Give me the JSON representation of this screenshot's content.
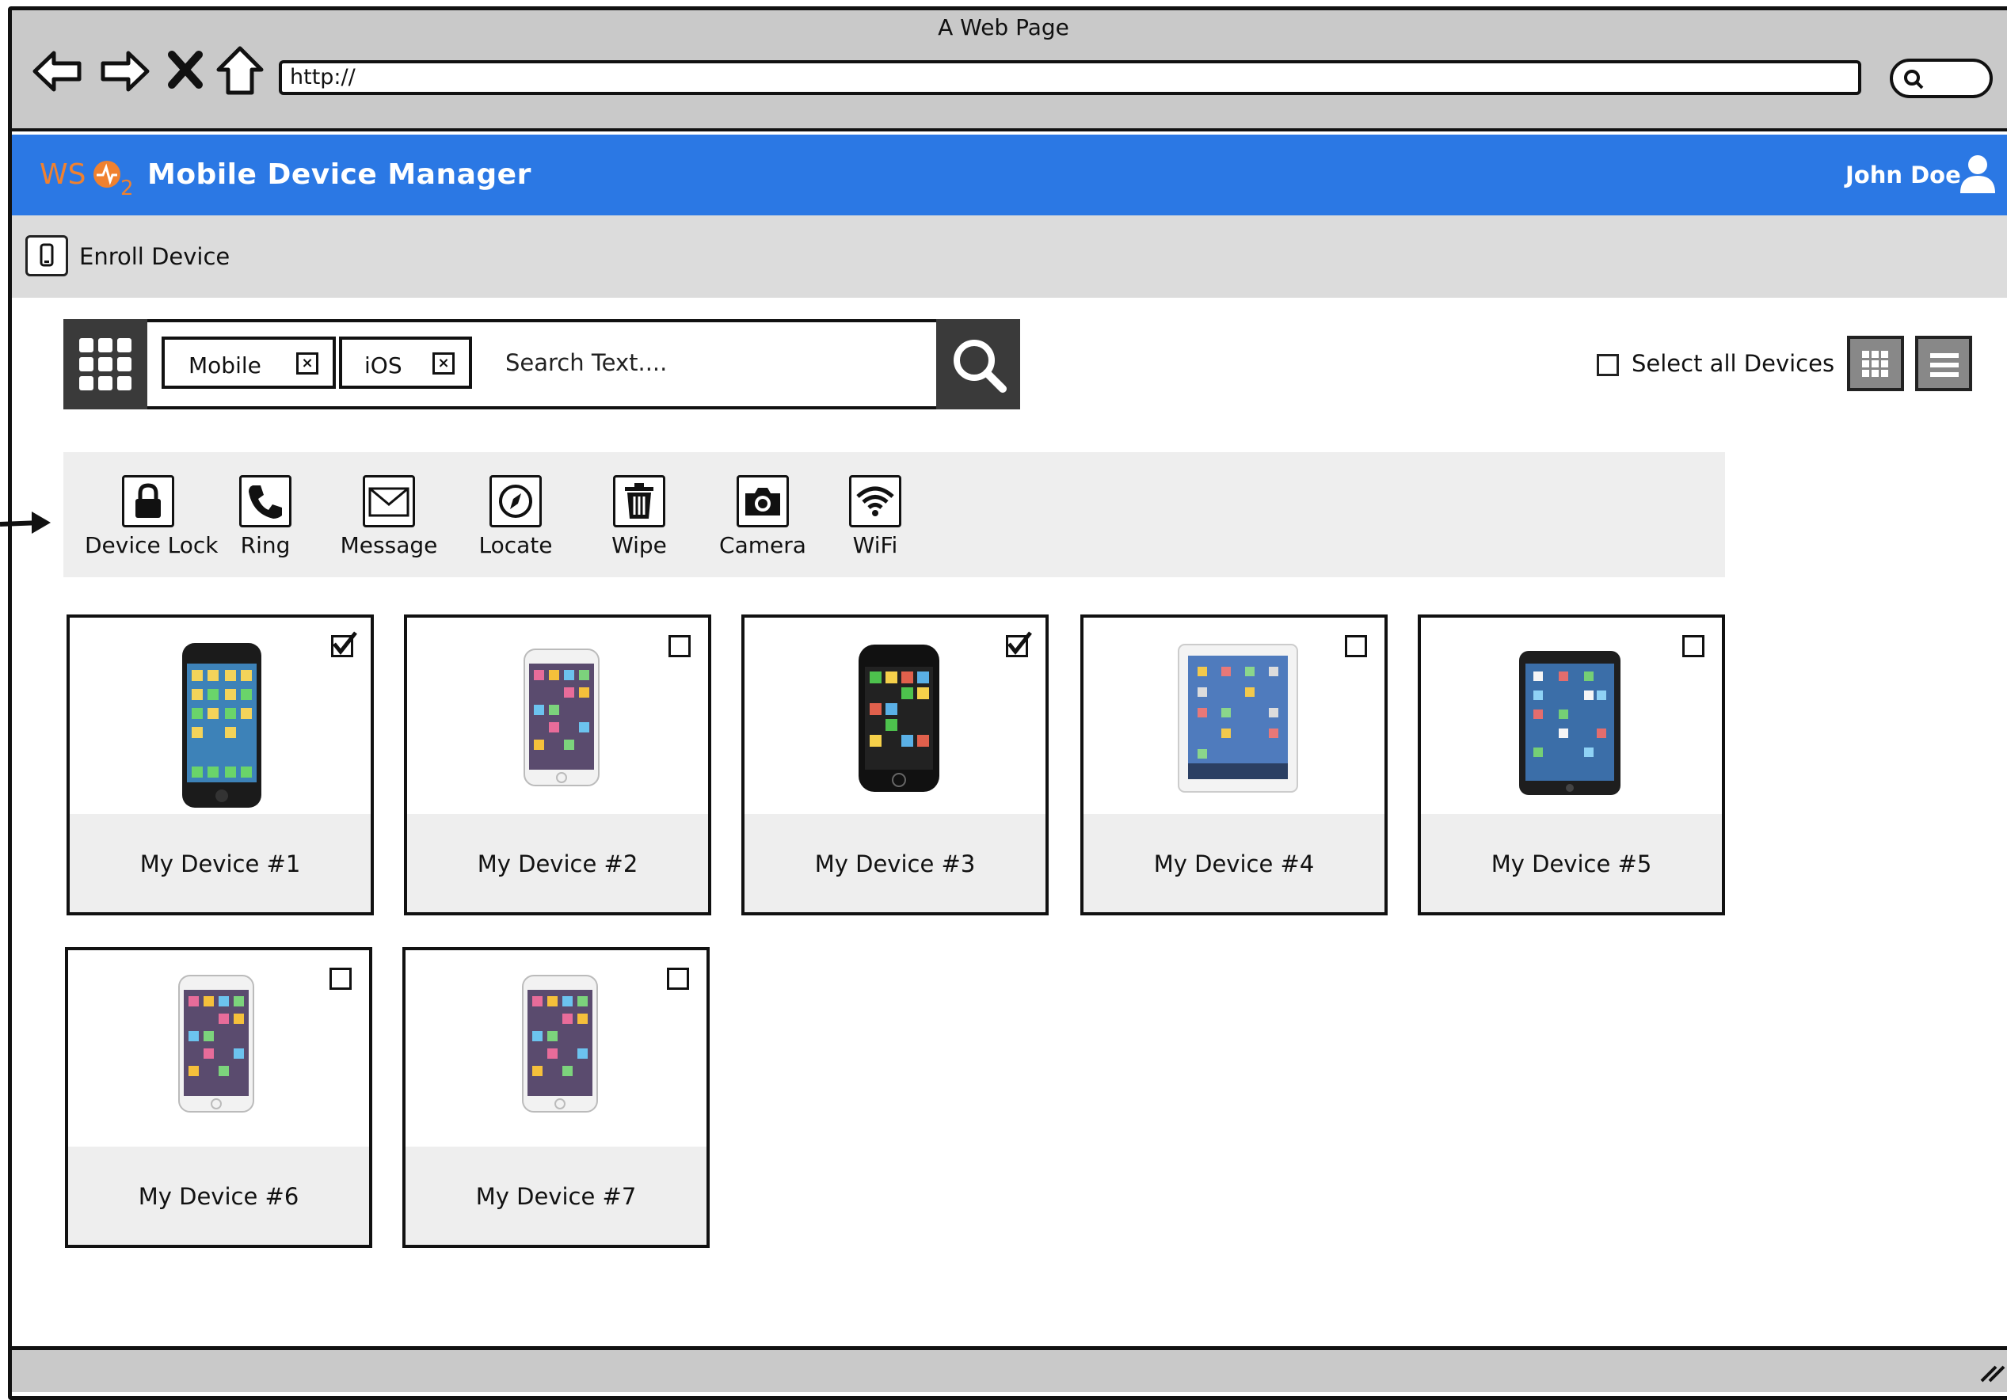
{
  "window": {
    "title": "A Web Page",
    "url": "http://"
  },
  "browser_nav": {
    "icons": [
      "back-arrow-icon",
      "forward-arrow-icon",
      "close-icon",
      "home-icon"
    ]
  },
  "header": {
    "title": "Mobile Device Manager",
    "user": "John Doe"
  },
  "subnav": {
    "enroll_label": "Enroll Device"
  },
  "search": {
    "chips": [
      {
        "label": "Mobile"
      },
      {
        "label": "iOS"
      }
    ],
    "placeholder": "Search Text...."
  },
  "select_all": {
    "label": "Select all Devices",
    "checked": false
  },
  "actions": [
    {
      "label": "Device Lock",
      "icon": "lock-icon"
    },
    {
      "label": "Ring",
      "icon": "phone-icon"
    },
    {
      "label": "Message",
      "icon": "envelope-icon"
    },
    {
      "label": "Locate",
      "icon": "compass-icon"
    },
    {
      "label": "Wipe",
      "icon": "trash-icon"
    },
    {
      "label": "Camera",
      "icon": "camera-icon"
    },
    {
      "label": "WiFi",
      "icon": "wifi-icon"
    }
  ],
  "devices": [
    {
      "name": "My Device #1",
      "checked": true,
      "kind": "iphone-black"
    },
    {
      "name": "My Device #2",
      "checked": false,
      "kind": "iphone-white"
    },
    {
      "name": "My Device #3",
      "checked": true,
      "kind": "iphone-old"
    },
    {
      "name": "My Device #4",
      "checked": false,
      "kind": "ipad-white"
    },
    {
      "name": "My Device #5",
      "checked": false,
      "kind": "ipad-mini"
    },
    {
      "name": "My Device #6",
      "checked": false,
      "kind": "iphone-white"
    },
    {
      "name": "My Device #7",
      "checked": false,
      "kind": "iphone-white"
    }
  ],
  "colors": {
    "header": "#2b78e4",
    "chrome": "#c9c9c9",
    "toolbar": "#eeeeee",
    "logo": "#f0812f"
  }
}
